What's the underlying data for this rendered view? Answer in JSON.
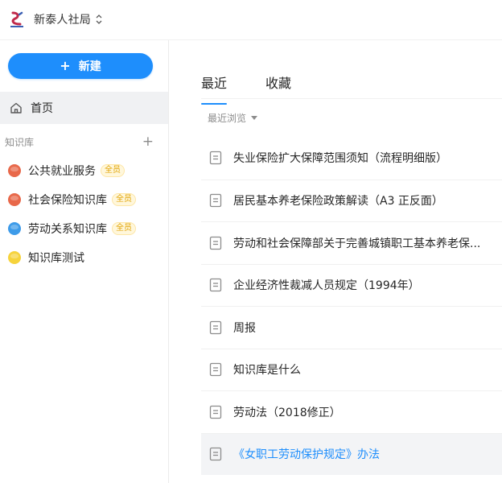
{
  "header": {
    "org_name": "新泰人社局"
  },
  "sidebar": {
    "new_button_label": "新建",
    "home_label": "首页",
    "kb_section_title": "知识库",
    "kb_add_symbol": "+",
    "knowledge_bases": [
      {
        "name": "公共就业服务",
        "badge": "全员",
        "color": "#e8684a"
      },
      {
        "name": "社会保险知识库",
        "badge": "全员",
        "color": "#e8684a"
      },
      {
        "name": "劳动关系知识库",
        "badge": "全员",
        "color": "#3d9be9"
      },
      {
        "name": "知识库测试",
        "badge": "",
        "color": "#f6d33c"
      }
    ]
  },
  "main": {
    "tabs": [
      {
        "label": "最近",
        "active": true
      },
      {
        "label": "收藏",
        "active": false
      }
    ],
    "filter_label": "最近浏览",
    "documents": [
      {
        "title": "失业保险扩大保障范围须知（流程明细版）"
      },
      {
        "title": "居民基本养老保险政策解读（A3 正反面）"
      },
      {
        "title": "劳动和社会保障部关于完善城镇职工基本养老保..."
      },
      {
        "title": "企业经济性裁减人员规定（1994年）"
      },
      {
        "title": "周报"
      },
      {
        "title": "知识库是什么"
      },
      {
        "title": "劳动法（2018修正）"
      },
      {
        "title": "《女职工劳动保护规定》办法"
      }
    ]
  },
  "colors": {
    "accent": "#1e8efc",
    "badge_text": "#e0a200",
    "highlight_bg": "#f3f4f6"
  },
  "icons": {
    "home": "home-icon",
    "document": "document-icon",
    "switch": "switch-icon"
  }
}
